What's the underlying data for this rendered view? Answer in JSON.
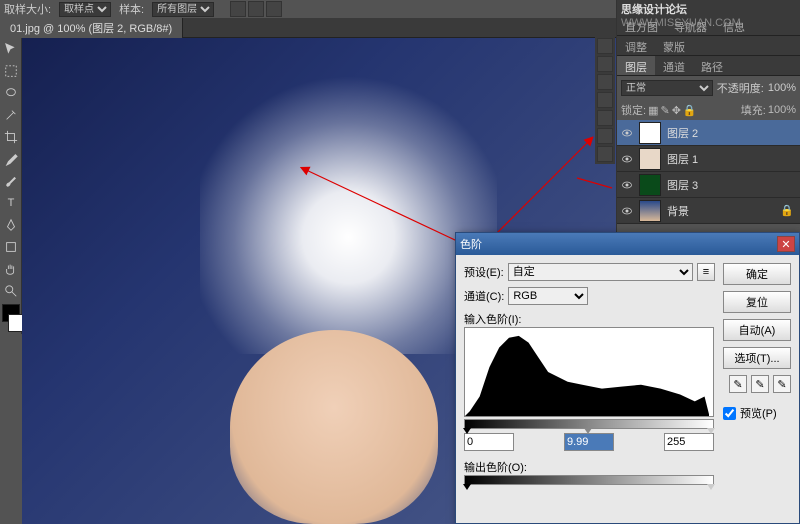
{
  "watermark": {
    "text": "思缘设计论坛",
    "url": "WWW.MISSYUAN.COM"
  },
  "top_bar": {
    "label1": "取样大小:",
    "select1": "取样点",
    "label2": "样本:",
    "select2": "所有图层"
  },
  "doc_tab": "01.jpg @ 100% (图层 2, RGB/8#) ",
  "nav_tabs": {
    "t1": "直方图",
    "t2": "导航器",
    "t3": "信息"
  },
  "adjust_tabs": {
    "t1": "调整",
    "t2": "蒙版"
  },
  "layer_tabs": {
    "t1": "图层",
    "t2": "通道",
    "t3": "路径"
  },
  "blend_mode": "正常",
  "opacity_label": "不透明度:",
  "opacity_val": "100%",
  "lock_label": "锁定:",
  "fill_label": "填充:",
  "fill_val": "100%",
  "layers": [
    {
      "name": "图层 2",
      "selected": true
    },
    {
      "name": "图层 1",
      "selected": false
    },
    {
      "name": "图层 3",
      "selected": false
    },
    {
      "name": "背景",
      "selected": false
    }
  ],
  "dialog": {
    "title": "色阶",
    "preset_label": "预设(E):",
    "preset_val": "自定",
    "channel_label": "通道(C):",
    "channel_val": "RGB",
    "input_label": "输入色阶(I):",
    "output_label": "输出色阶(O):",
    "black": "0",
    "gamma": "9.99",
    "white": "255",
    "btn_ok": "确定",
    "btn_cancel": "复位",
    "btn_auto": "自动(A)",
    "btn_options": "选项(T)...",
    "preview_label": "预览(P)"
  }
}
